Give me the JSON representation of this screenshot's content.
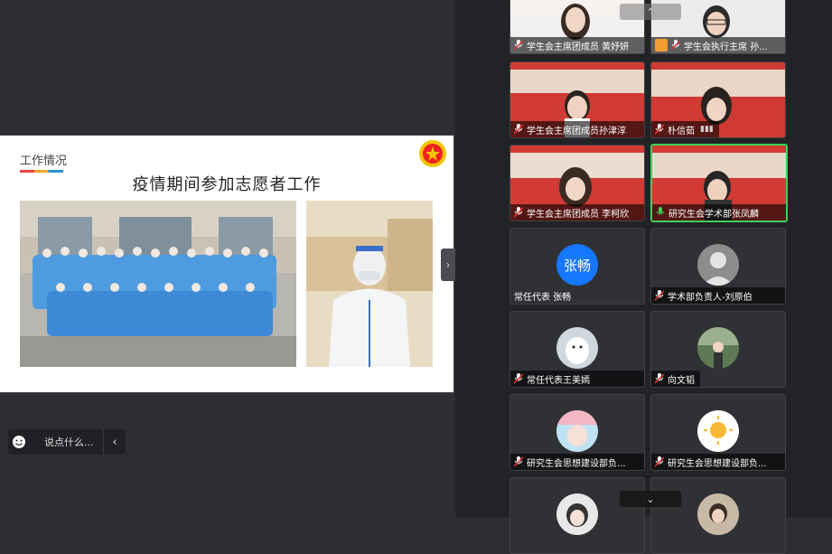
{
  "slide": {
    "section": "工作情况",
    "title": "疫情期间参加志愿者工作"
  },
  "chat": {
    "placeholder": "说点什么..."
  },
  "participants": [
    {
      "label": "学生会主席团成员  黄妤妍",
      "type": "video"
    },
    {
      "label": "学生会执行主席 孙...",
      "type": "video"
    },
    {
      "label": "学生会主席团成员孙津淳",
      "type": "video"
    },
    {
      "label": "朴信茹",
      "type": "video"
    },
    {
      "label": "学生会主席团成员  李柯欣",
      "type": "video"
    },
    {
      "label": "研究生会学术部张凤麟",
      "type": "video"
    },
    {
      "label": "常任代表 张畅",
      "type": "avatar",
      "avatar_text": "张畅"
    },
    {
      "label": "学术部负责人-刘原伯",
      "type": "avatar"
    },
    {
      "label": "常任代表王美嫣",
      "type": "avatar"
    },
    {
      "label": "向文韬",
      "type": "avatar"
    },
    {
      "label": "研究生会思想建设部负...",
      "type": "avatar"
    },
    {
      "label": "研究生会思想建设部负...",
      "type": "avatar"
    }
  ],
  "colors": {
    "speaking_border": "#3fcf5a",
    "avatar_blue": "#1677ff"
  }
}
